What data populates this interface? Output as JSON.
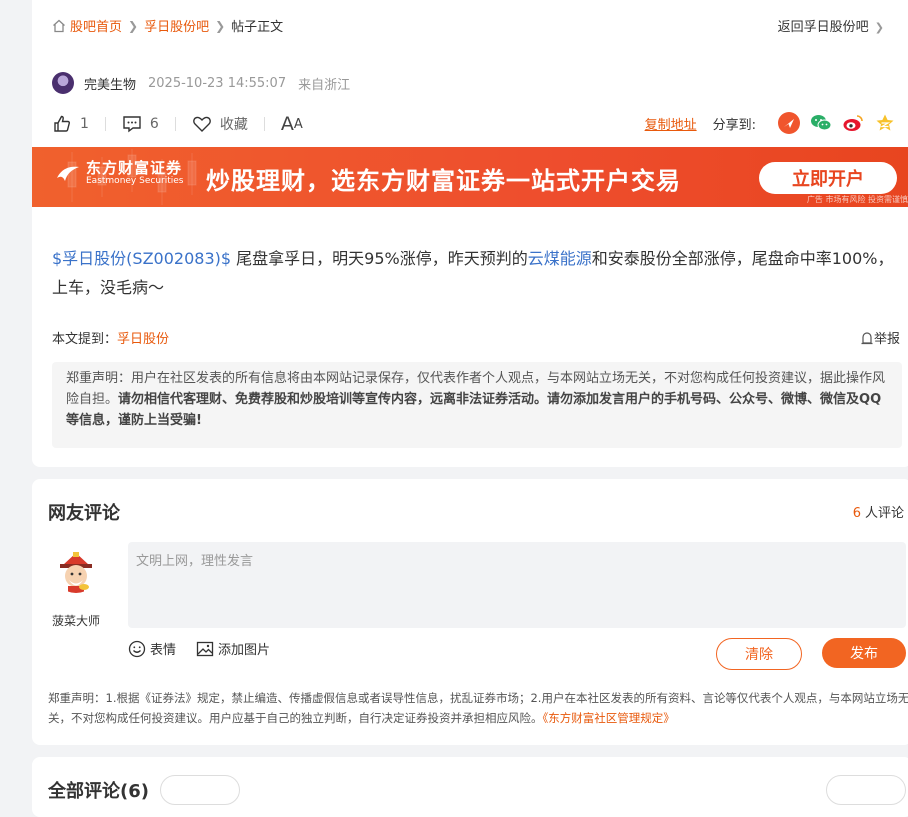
{
  "breadcrumb": {
    "home": "股吧首页",
    "bar": "孚日股份吧",
    "current": "帖子正文"
  },
  "back_link": "返回孚日股份吧",
  "author": {
    "name": "完美生物",
    "time": "2025-10-23 14:55:07",
    "location": "来自浙江"
  },
  "actions": {
    "likes": "1",
    "comments": "6",
    "favorite": "收藏",
    "font_big": "A",
    "font_small": "A"
  },
  "share": {
    "copy": "复制地址",
    "label": "分享到:"
  },
  "banner": {
    "logo_cn": "东方财富证券",
    "logo_en": "Eastmoney Securities",
    "slogan": "炒股理财，选东方财富证券一站式开户交易",
    "button": "立即开户",
    "ad": "广告 市场有风险 投资需谨慎"
  },
  "post": {
    "stock_tag": "$孚日股份(SZ002083)$",
    "text_a": " 尾盘拿孚日，明天95%涨停，昨天预判的",
    "keyword": "云煤能源",
    "text_b": "和安泰股份全部涨停，尾盘命中率100%，上车，没毛病～"
  },
  "mention": {
    "label": "本文提到：",
    "stock": "孚日股份"
  },
  "report": "举报",
  "disclaimer": {
    "normal": "郑重声明：用户在社区发表的所有信息将由本网站记录保存，仅代表作者个人观点，与本网站立场无关，不对您构成任何投资建议，据此操作风险自担。",
    "bold": "请勿相信代客理财、免费荐股和炒股培训等宣传内容，远离非法证券活动。请勿添加发言用户的手机号码、公众号、微博、微信及QQ等信息，谨防上当受骗!"
  },
  "comments": {
    "title": "网友评论",
    "count": "6",
    "count_suffix": "人评论",
    "user": "菠菜大师",
    "placeholder": "文明上网，理性发言",
    "emoji": "表情",
    "image": "添加图片",
    "clear": "清除",
    "post": "发布",
    "notice": "郑重声明：1.根据《证券法》规定，禁止编造、传播虚假信息或者误导性信息，扰乱证券市场；2.用户在本社区发表的所有资料、言论等仅代表个人观点，与本网站立场无关，不对您构成任何投资建议。用户应基于自己的独立判断，自行决定证券投资并承担相应风险。",
    "rule": "《东方财富社区管理规定》"
  },
  "all_comments": {
    "title": "全部评论(6)"
  },
  "colors": {
    "accent": "#e8590c",
    "link": "#3a72c9",
    "banner": "#ee4d2d"
  }
}
